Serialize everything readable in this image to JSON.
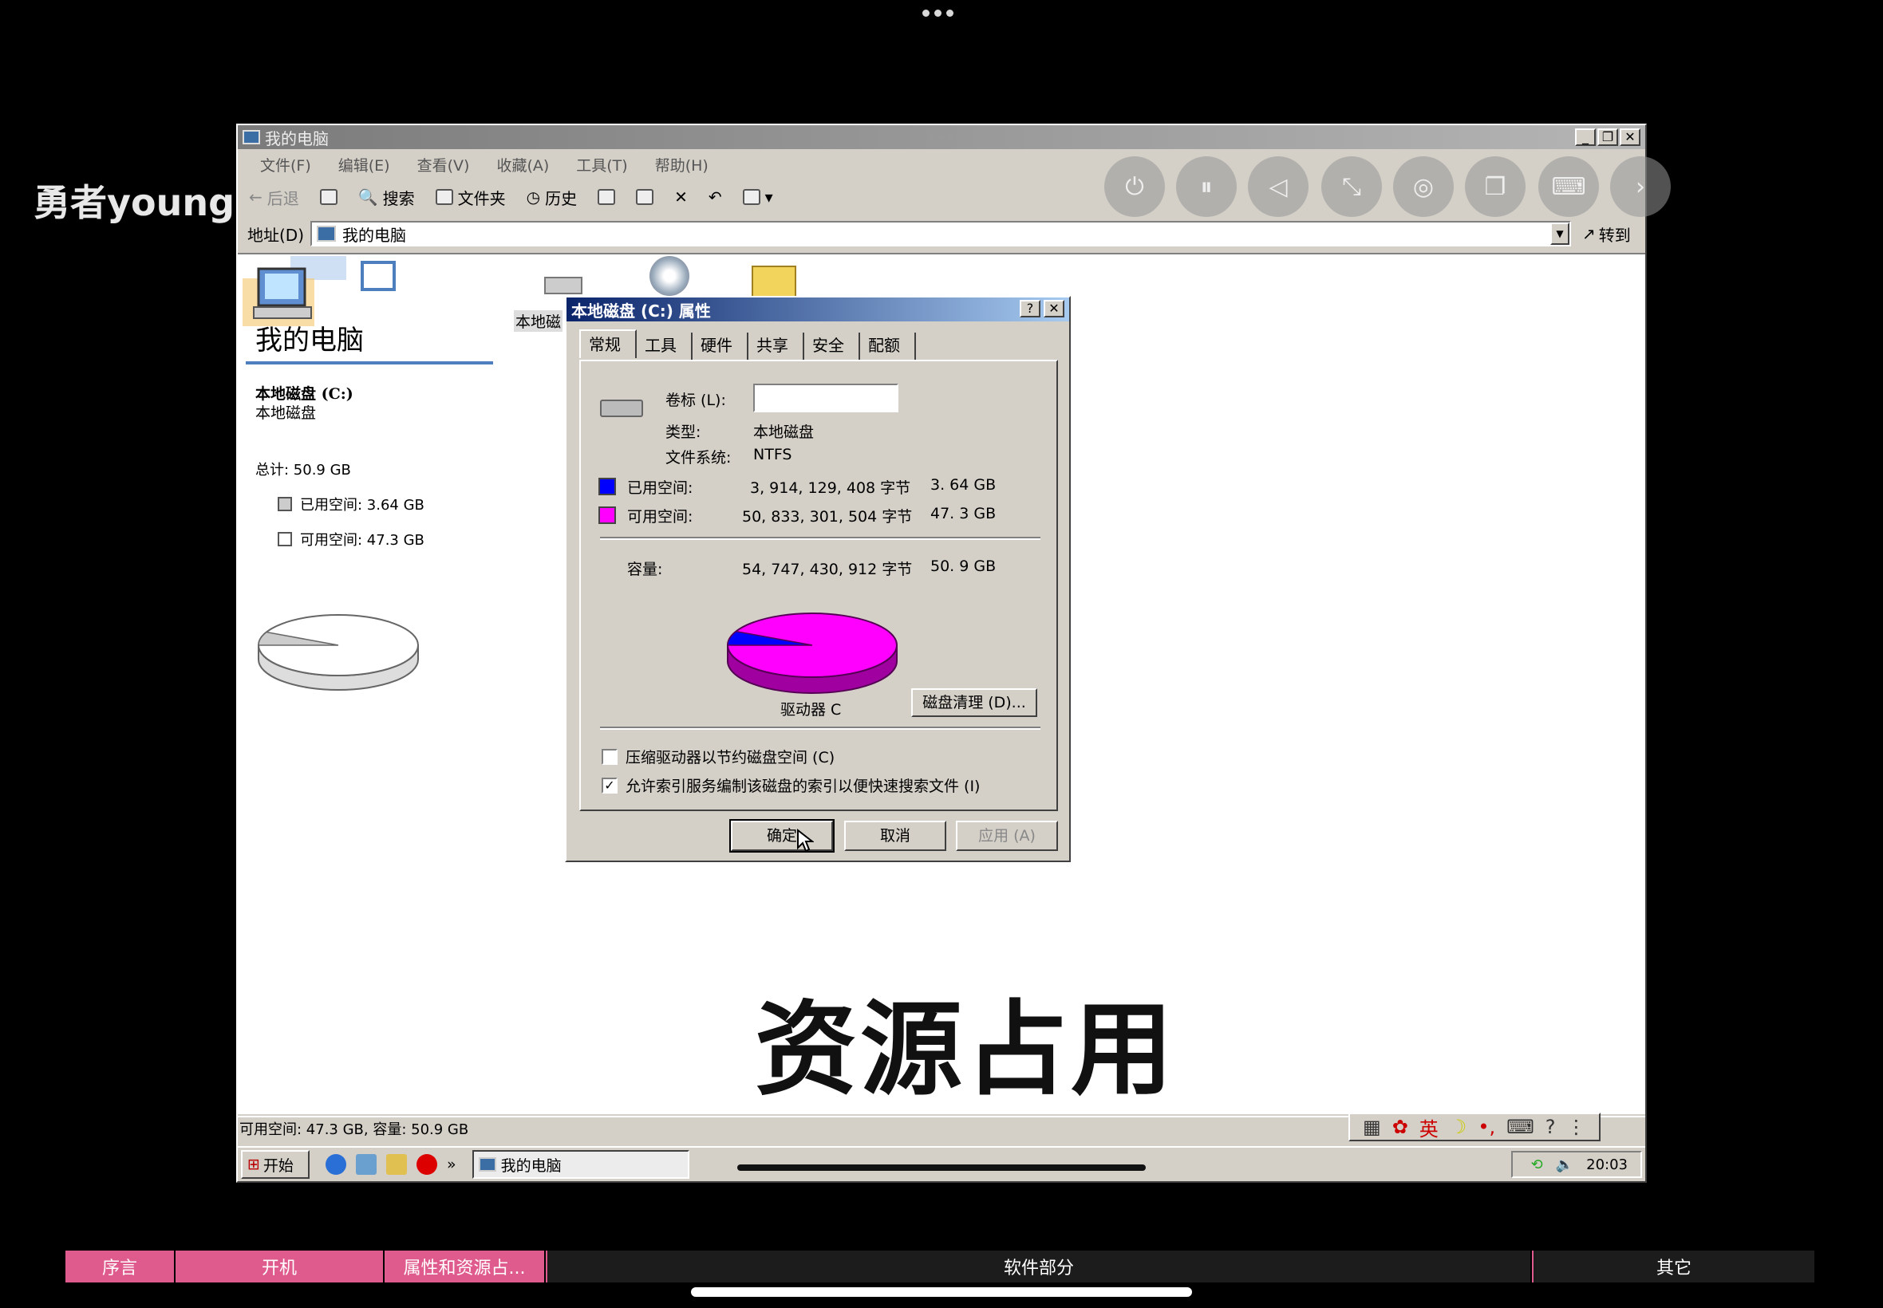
{
  "overlay": {
    "watermark": "勇者young",
    "caption": "资源占用",
    "controls": [
      "power-icon",
      "pause-icon",
      "back-icon",
      "minimize-icon",
      "compass-icon",
      "window-icon",
      "keyboard-icon",
      "next-icon"
    ]
  },
  "window": {
    "title": "我的电脑",
    "menu": [
      "文件(F)",
      "编辑(E)",
      "查看(V)",
      "收藏(A)",
      "工具(T)",
      "帮助(H)"
    ],
    "toolbar": {
      "back": "后退",
      "search": "搜索",
      "folders": "文件夹",
      "history": "历史"
    },
    "address": {
      "label": "地址(D)",
      "value": "我的电脑",
      "go": "转到"
    },
    "left_panel": {
      "title": "我的电脑",
      "drive_name": "本地磁盘 (C:)",
      "drive_type": "本地磁盘",
      "total": "总计: 50.9 GB",
      "used": "已用空间: 3.64 GB",
      "free": "可用空间: 47.3 GB",
      "used_fraction": 0.0715
    },
    "icon_label": "本地磁",
    "status": "可用空间: 47.3 GB, 容量: 50.9 GB",
    "ime": "英",
    "taskbar": {
      "start": "开始",
      "task": "我的电脑",
      "more": "»",
      "time": "20:03"
    }
  },
  "dialog": {
    "title": "本地磁盘 (C:) 属性",
    "tabs": [
      "常规",
      "工具",
      "硬件",
      "共享",
      "安全",
      "配额"
    ],
    "labels": {
      "volume": "卷标 (L):",
      "type": "类型:",
      "fs": "文件系统:",
      "used": "已用空间:",
      "free": "可用空间:",
      "capacity": "容量:"
    },
    "values": {
      "volume": "",
      "type": "本地磁盘",
      "fs": "NTFS",
      "used_bytes": "3, 914, 129, 408 字节",
      "used_gb": "3. 64 GB",
      "free_bytes": "50, 833, 301, 504 字节",
      "free_gb": "47. 3 GB",
      "capacity_bytes": "54, 747, 430, 912 字节",
      "capacity_gb": "50. 9 GB"
    },
    "drive_label": "驱动器 C",
    "cleanup": "磁盘清理 (D)...",
    "compress": "压缩驱动器以节约磁盘空间 (C)",
    "index": "允许索引服务编制该磁盘的索引以便快速搜索文件 (I)",
    "compress_checked": false,
    "index_checked": true,
    "ok": "确定",
    "cancel": "取消",
    "apply": "应用 (A)",
    "used_fraction": 0.0715,
    "colors": {
      "used": "#0000ff",
      "free": "#ff00ff"
    }
  },
  "chapters": [
    "序言",
    "开机",
    "属性和资源占...",
    "软件部分",
    "其它"
  ]
}
